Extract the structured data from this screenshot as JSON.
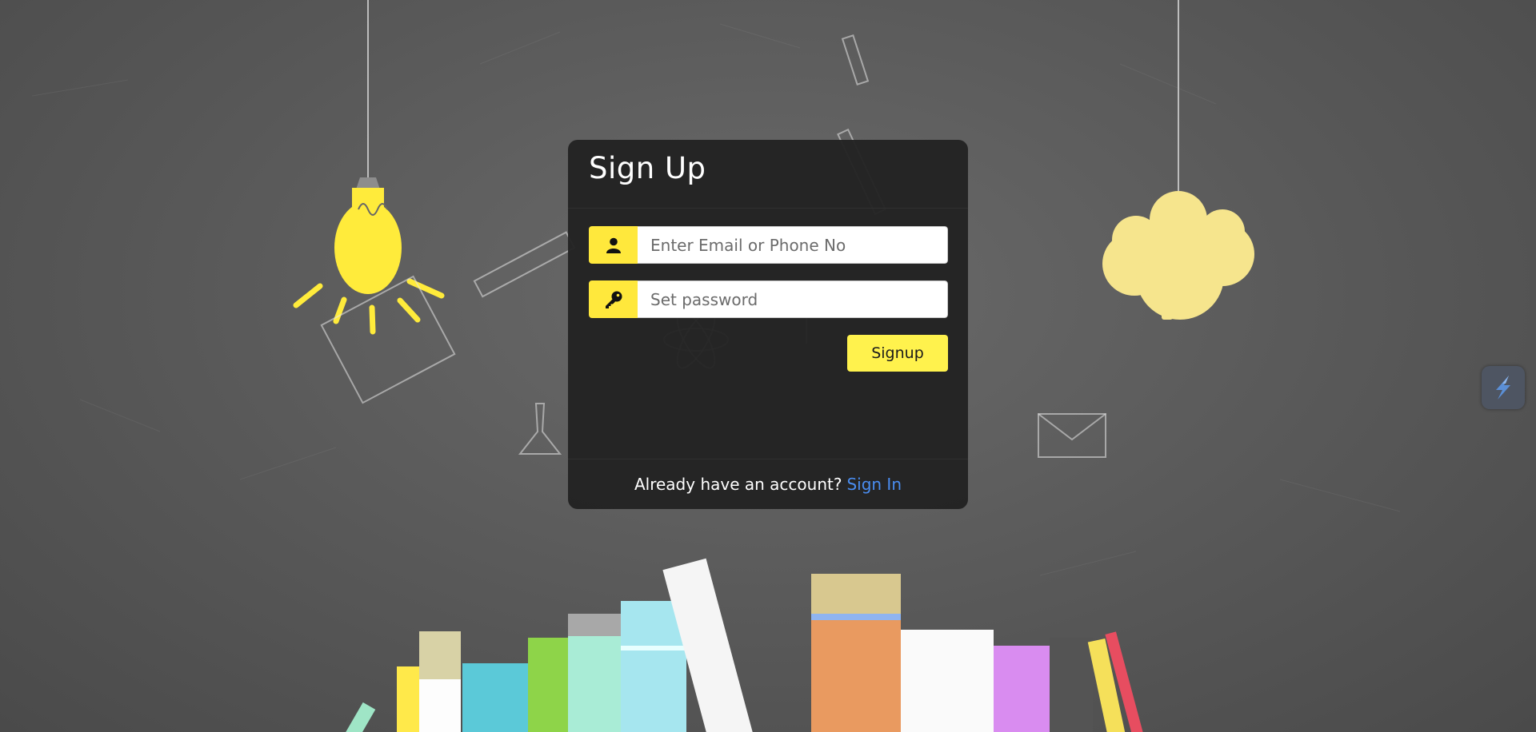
{
  "signup": {
    "title": "Sign Up",
    "email_placeholder": "Enter Email or Phone No",
    "email_value": "",
    "password_placeholder": "Set password",
    "password_value": "",
    "submit_label": "Signup",
    "footer_text": "Already have an account?",
    "footer_link": "Sign In"
  },
  "icons": {
    "user": "user-icon",
    "password": "key-icon",
    "widget": "extension-widget-icon"
  },
  "colors": {
    "accent": "#ffe83c",
    "button": "#fff24d",
    "link": "#4a8df0",
    "card": "#222222"
  }
}
